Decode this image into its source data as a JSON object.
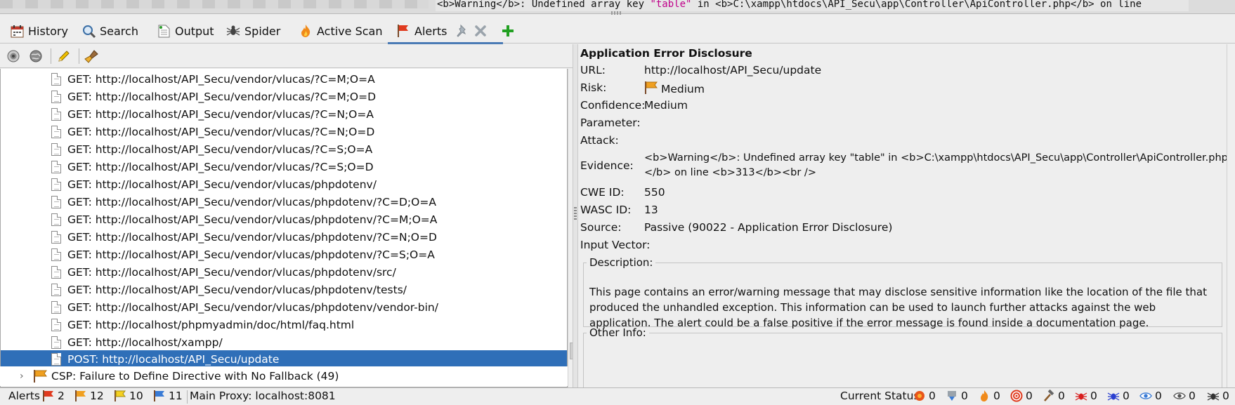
{
  "top_code": {
    "pre": "<b>Warning</b>:  Undefined array key ",
    "str": "\"table\"",
    "post": " in <b>C:\\xampp\\htdocs\\API_Secu\\app\\Controller\\ApiController.php</b> on line"
  },
  "tabs": [
    {
      "label": "History",
      "icon": "calendar-icon"
    },
    {
      "label": "Search",
      "icon": "magnifier-icon"
    },
    {
      "label": "Output",
      "icon": "document-icon"
    },
    {
      "label": "Spider",
      "icon": "spider-icon"
    },
    {
      "label": "Active Scan",
      "icon": "flame-icon"
    },
    {
      "label": "Alerts",
      "icon": "flag-icon",
      "active": true
    }
  ],
  "colors": {
    "selection": "#2f6fb8",
    "flag_high": "#e03a1e",
    "flag_medium": "#f0a020",
    "flag_low": "#f5d020",
    "flag_info": "#3a7bd5",
    "tab_active": "#4a7bb5",
    "plus": "#22a022"
  },
  "tree": {
    "rows": [
      "GET: http://localhost/API_Secu/vendor/vlucas/?C=M;O=A",
      "GET: http://localhost/API_Secu/vendor/vlucas/?C=M;O=D",
      "GET: http://localhost/API_Secu/vendor/vlucas/?C=N;O=A",
      "GET: http://localhost/API_Secu/vendor/vlucas/?C=N;O=D",
      "GET: http://localhost/API_Secu/vendor/vlucas/?C=S;O=A",
      "GET: http://localhost/API_Secu/vendor/vlucas/?C=S;O=D",
      "GET: http://localhost/API_Secu/vendor/vlucas/phpdotenv/",
      "GET: http://localhost/API_Secu/vendor/vlucas/phpdotenv/?C=D;O=A",
      "GET: http://localhost/API_Secu/vendor/vlucas/phpdotenv/?C=M;O=A",
      "GET: http://localhost/API_Secu/vendor/vlucas/phpdotenv/?C=N;O=D",
      "GET: http://localhost/API_Secu/vendor/vlucas/phpdotenv/?C=S;O=A",
      "GET: http://localhost/API_Secu/vendor/vlucas/phpdotenv/src/",
      "GET: http://localhost/API_Secu/vendor/vlucas/phpdotenv/tests/",
      "GET: http://localhost/API_Secu/vendor/vlucas/phpdotenv/vendor-bin/",
      "GET: http://localhost/phpmyadmin/doc/html/faq.html",
      "GET: http://localhost/xampp/",
      "POST: http://localhost/API_Secu/update"
    ],
    "selected_index": 16,
    "category": "CSP: Failure to Define Directive with No Fallback (49)"
  },
  "detail": {
    "title": "Application Error Disclosure",
    "url_label": "URL:",
    "url": "http://localhost/API_Secu/update",
    "risk_label": "Risk:",
    "risk": "Medium",
    "confidence_label": "Confidence:",
    "confidence": "Medium",
    "parameter_label": "Parameter:",
    "attack_label": "Attack:",
    "evidence_label": "Evidence:",
    "evidence": "<b>Warning</b>:  Undefined array key \"table\" in <b>C:\\xampp\\htdocs\\API_Secu\\app\\Controller\\ApiController.php</b> on line <b>313</b><br />",
    "cwe_label": "CWE ID:",
    "cwe": "550",
    "wasc_label": "WASC ID:",
    "wasc": "13",
    "source_label": "Source:",
    "source": "Passive (90022 - Application Error Disclosure)",
    "input_vector_label": "Input Vector:",
    "description_legend": "Description:",
    "description": "This page contains an error/warning message that may disclose sensitive information like the location of the file that produced the unhandled exception. This information can be used to launch further attacks against the web application. The alert could be a false positive if the error message is found inside a documentation page.",
    "other_info_legend": "Other Info:"
  },
  "status": {
    "alerts_label": "Alerts",
    "high": "2",
    "medium": "12",
    "low": "10",
    "info": "11",
    "proxy": "Main Proxy: localhost:8081",
    "current_status_label": "Current Status",
    "counters": [
      "0",
      "0",
      "0",
      "0",
      "0",
      "0",
      "0",
      "0",
      "0",
      "0"
    ]
  }
}
